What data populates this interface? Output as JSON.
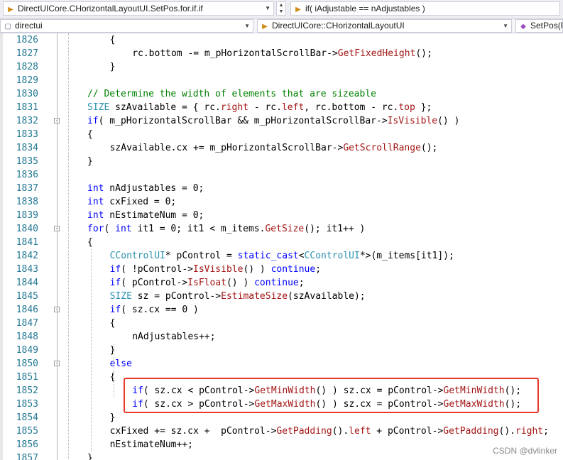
{
  "navigation": {
    "scope_combo": {
      "icon": "arrow-right-icon",
      "label": "DirectUICore.CHorizontalLayoutUI.SetPos.for.if.if"
    },
    "statement_combo": {
      "icon": "arrow-right-icon",
      "label": "if( iAdjustable == nAdjustables )"
    },
    "project_combo": {
      "icon": "cpp-file-icon",
      "label": "directui"
    },
    "class_combo": {
      "icon": "arrow-right-icon",
      "label": "DirectUICore::CHorizontalLayoutUI"
    },
    "member_combo": {
      "icon": "method-icon",
      "label": "SetPos(R"
    }
  },
  "editor": {
    "language": "cpp",
    "lines": [
      {
        "number": "1826",
        "segments": [
          {
            "t": "{",
            "c": ""
          }
        ]
      },
      {
        "number": "1827",
        "segments": [
          {
            "t": "rc.bottom -= m_pHorizontalScrollBar->",
            "c": ""
          },
          {
            "t": "GetFixedHeight",
            "c": "fn"
          },
          {
            "t": "();",
            "c": ""
          }
        ]
      },
      {
        "number": "1828",
        "segments": [
          {
            "t": "}",
            "c": ""
          }
        ]
      },
      {
        "number": "1829",
        "segments": []
      },
      {
        "number": "1830",
        "segments": [
          {
            "t": "// Determine the width of elements that are sizeable",
            "c": "cm"
          }
        ]
      },
      {
        "number": "1831",
        "segments": [
          {
            "t": "SIZE",
            "c": "ty"
          },
          {
            "t": " szAvailable = { rc.",
            "c": ""
          },
          {
            "t": "right",
            "c": "fn"
          },
          {
            "t": " - rc.",
            "c": ""
          },
          {
            "t": "left",
            "c": "fn"
          },
          {
            "t": ", rc.bottom - rc.",
            "c": ""
          },
          {
            "t": "top",
            "c": "fn"
          },
          {
            "t": " };",
            "c": ""
          }
        ]
      },
      {
        "number": "1832",
        "segments": [
          {
            "t": "if",
            "c": "kw"
          },
          {
            "t": "( m_pHorizontalScrollBar && m_pHorizontalScrollBar->",
            "c": ""
          },
          {
            "t": "IsVisible",
            "c": "fn"
          },
          {
            "t": "() )",
            "c": ""
          }
        ]
      },
      {
        "number": "1833",
        "segments": [
          {
            "t": "{",
            "c": ""
          }
        ]
      },
      {
        "number": "1834",
        "segments": [
          {
            "t": "szAvailable.cx += m_pHorizontalScrollBar->",
            "c": ""
          },
          {
            "t": "GetScrollRange",
            "c": "fn"
          },
          {
            "t": "();",
            "c": ""
          }
        ]
      },
      {
        "number": "1835",
        "segments": [
          {
            "t": "}",
            "c": ""
          }
        ]
      },
      {
        "number": "1836",
        "segments": []
      },
      {
        "number": "1837",
        "segments": [
          {
            "t": "int",
            "c": "kw"
          },
          {
            "t": " nAdjustables = 0;",
            "c": ""
          }
        ]
      },
      {
        "number": "1838",
        "segments": [
          {
            "t": "int",
            "c": "kw"
          },
          {
            "t": " cxFixed = 0;",
            "c": ""
          }
        ]
      },
      {
        "number": "1839",
        "segments": [
          {
            "t": "int",
            "c": "kw"
          },
          {
            "t": " nEstimateNum = 0;",
            "c": ""
          }
        ]
      },
      {
        "number": "1840",
        "segments": [
          {
            "t": "for",
            "c": "kw"
          },
          {
            "t": "( ",
            "c": ""
          },
          {
            "t": "int",
            "c": "kw"
          },
          {
            "t": " it1 = 0; it1 < m_items.",
            "c": ""
          },
          {
            "t": "GetSize",
            "c": "fn"
          },
          {
            "t": "(); it1++ )",
            "c": ""
          }
        ]
      },
      {
        "number": "1841",
        "segments": [
          {
            "t": "{",
            "c": ""
          }
        ]
      },
      {
        "number": "1842",
        "segments": [
          {
            "t": "CControlUI",
            "c": "ty"
          },
          {
            "t": "* pControl = ",
            "c": ""
          },
          {
            "t": "static_cast",
            "c": "kw"
          },
          {
            "t": "<",
            "c": ""
          },
          {
            "t": "CControlUI",
            "c": "ty"
          },
          {
            "t": "*>(m_items[it1]);",
            "c": ""
          }
        ]
      },
      {
        "number": "1843",
        "segments": [
          {
            "t": "if",
            "c": "kw"
          },
          {
            "t": "( !pControl->",
            "c": ""
          },
          {
            "t": "IsVisible",
            "c": "fn"
          },
          {
            "t": "() ) ",
            "c": ""
          },
          {
            "t": "continue",
            "c": "kw"
          },
          {
            "t": ";",
            "c": ""
          }
        ]
      },
      {
        "number": "1844",
        "segments": [
          {
            "t": "if",
            "c": "kw"
          },
          {
            "t": "( pControl->",
            "c": ""
          },
          {
            "t": "IsFloat",
            "c": "fn"
          },
          {
            "t": "() ) ",
            "c": ""
          },
          {
            "t": "continue",
            "c": "kw"
          },
          {
            "t": ";",
            "c": ""
          }
        ]
      },
      {
        "number": "1845",
        "segments": [
          {
            "t": "SIZE",
            "c": "ty"
          },
          {
            "t": " sz = pControl->",
            "c": ""
          },
          {
            "t": "EstimateSize",
            "c": "fn"
          },
          {
            "t": "(szAvailable);",
            "c": ""
          }
        ]
      },
      {
        "number": "1846",
        "segments": [
          {
            "t": "if",
            "c": "kw"
          },
          {
            "t": "( sz.cx == 0 )",
            "c": ""
          }
        ]
      },
      {
        "number": "1847",
        "segments": [
          {
            "t": "{",
            "c": ""
          }
        ]
      },
      {
        "number": "1848",
        "segments": [
          {
            "t": "nAdjustables++;",
            "c": ""
          }
        ]
      },
      {
        "number": "1849",
        "segments": [
          {
            "t": "}",
            "c": ""
          }
        ]
      },
      {
        "number": "1850",
        "segments": [
          {
            "t": "else",
            "c": "kw"
          }
        ]
      },
      {
        "number": "1851",
        "segments": [
          {
            "t": "{",
            "c": ""
          }
        ]
      },
      {
        "number": "1852",
        "segments": [
          {
            "t": "if",
            "c": "kw"
          },
          {
            "t": "( sz.cx < pControl->",
            "c": ""
          },
          {
            "t": "GetMinWidth",
            "c": "fn"
          },
          {
            "t": "() ) sz.cx = pControl->",
            "c": ""
          },
          {
            "t": "GetMinWidth",
            "c": "fn"
          },
          {
            "t": "();",
            "c": ""
          }
        ]
      },
      {
        "number": "1853",
        "segments": [
          {
            "t": "if",
            "c": "kw"
          },
          {
            "t": "( sz.cx > pControl->",
            "c": ""
          },
          {
            "t": "GetMaxWidth",
            "c": "fn"
          },
          {
            "t": "() ) sz.cx = pControl->",
            "c": ""
          },
          {
            "t": "GetMaxWidth",
            "c": "fn"
          },
          {
            "t": "();",
            "c": ""
          }
        ]
      },
      {
        "number": "1854",
        "segments": [
          {
            "t": "}",
            "c": ""
          }
        ]
      },
      {
        "number": "1855",
        "segments": [
          {
            "t": "cxFixed += sz.cx +  pControl->",
            "c": ""
          },
          {
            "t": "GetPadding",
            "c": "fn"
          },
          {
            "t": "().",
            "c": ""
          },
          {
            "t": "left",
            "c": "fn"
          },
          {
            "t": " + pControl->",
            "c": ""
          },
          {
            "t": "GetPadding",
            "c": "fn"
          },
          {
            "t": "().",
            "c": ""
          },
          {
            "t": "right",
            "c": "fn"
          },
          {
            "t": ";",
            "c": ""
          }
        ]
      },
      {
        "number": "1856",
        "segments": [
          {
            "t": "nEstimateNum++;",
            "c": ""
          }
        ]
      },
      {
        "number": "1857",
        "segments": [
          {
            "t": "}",
            "c": ""
          }
        ]
      }
    ]
  },
  "watermark": "CSDN @dvlinker",
  "colors": {
    "keyword": "#0000ff",
    "type": "#2b91af",
    "function": "#a31515",
    "comment": "#008000",
    "line_number": "#237893",
    "highlight_border": "#e8382a"
  }
}
